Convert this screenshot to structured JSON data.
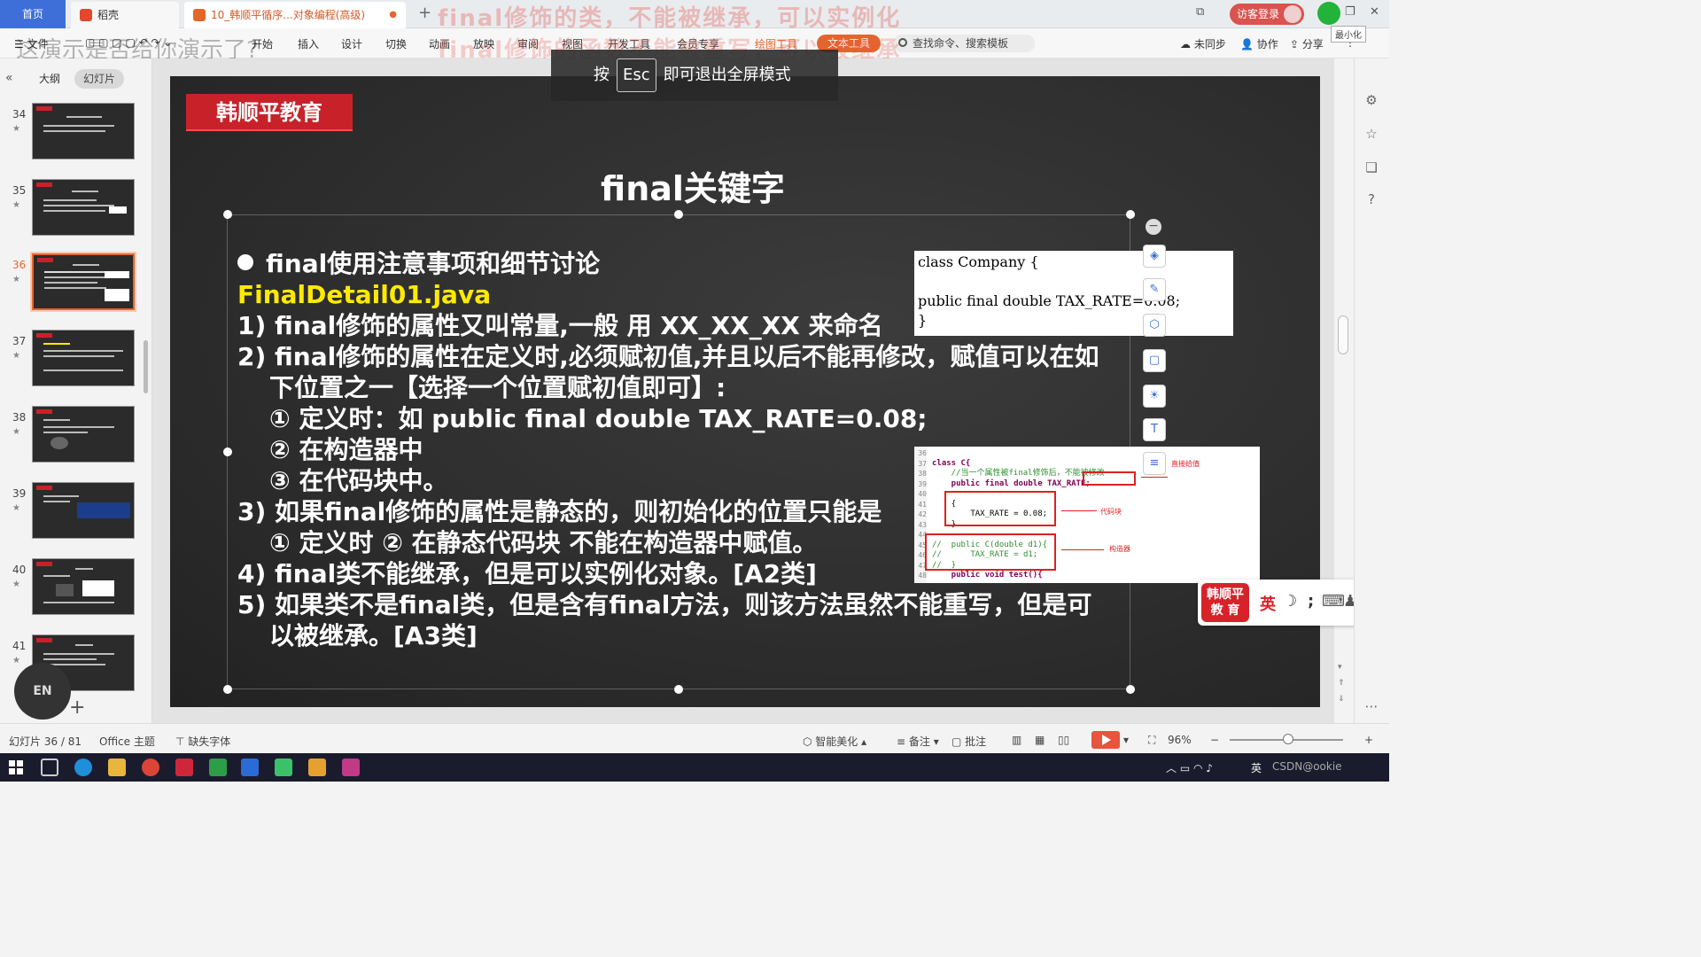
{
  "tabs": {
    "home": "首页",
    "doc": "稻壳",
    "ppt": "10_韩顺平循序...对象编程(高级)"
  },
  "overlay_text": {
    "line1": "final修饰的类，不能被继承，可以实例化",
    "line2": "final修饰的函数不能被重写，可以被继承",
    "sub": "这演示是否给你演示了?"
  },
  "window": {
    "login": "访客登录",
    "minimize_tip": "最小化"
  },
  "ribbon": {
    "file": "文件",
    "items": [
      "开始",
      "插入",
      "设计",
      "切换",
      "动画",
      "放映",
      "审阅",
      "视图",
      "开发工具",
      "会员专享"
    ],
    "drawing_tools": "绘图工具",
    "text_tools": "文本工具",
    "search": "查找命令、搜索模板",
    "unsynced": "未同步",
    "collab": "协作",
    "share": "分享"
  },
  "leftpanel": {
    "outline_tab": "大纲",
    "slides_tab": "幻灯片",
    "thumb_numbers": [
      "34",
      "35",
      "36",
      "37",
      "38",
      "39",
      "40",
      "41"
    ],
    "current": "36",
    "en_button": "EN"
  },
  "esc_hint": {
    "prefix": "按",
    "key": "Esc",
    "suffix": "即可退出全屏模式"
  },
  "slide": {
    "brand": "韩顺平教育",
    "title": "final关键字",
    "heading": "final使用注意事项和细节讨论",
    "filename": "FinalDetail01.java",
    "lines": [
      "1) final修饰的属性又叫常量,一般 用 XX_XX_XX 来命名",
      "2) final修饰的属性在定义时,必须赋初值,并且以后不能再修改，赋值可以在如",
      "下位置之一【选择一个位置赋初值即可】:",
      "① 定义时：如 public final double TAX_RATE=0.08;",
      "② 在构造器中",
      "③ 在代码块中。",
      "3) 如果final修饰的属性是静态的，则初始化的位置只能是",
      "① 定义时   ② 在静态代码块 不能在构造器中赋值。",
      "4) final类不能继承，但是可以实例化对象。[A2类]",
      "5) 如果类不是final类，但是含有final方法，则该方法虽然不能重写，但是可",
      "以被继承。[A3类]"
    ],
    "code1": [
      "class Company {",
      "",
      "public final double TAX_RATE=0.08;",
      "}"
    ],
    "code2": {
      "line_numbers": [
        "36",
        "37",
        "38",
        "39",
        "40",
        "41",
        "42",
        "43",
        "44",
        "45",
        "46",
        "47",
        "48"
      ],
      "lines": [
        "",
        "class C{",
        "    //当一个属性被final修饰后，不能被修改",
        "    public final double TAX_RATE;",
        "",
        "    {",
        "        TAX_RATE = 0.08;",
        "    }",
        "",
        "//  public C(double d1){",
        "//      TAX_RATE = d1;",
        "//  }",
        "    public void test(){"
      ],
      "annotations": [
        "直接给值",
        "代码块",
        "构造器"
      ]
    }
  },
  "ime": {
    "logo_line1": "韩顺平",
    "logo_line2": "教 育",
    "lang": "英"
  },
  "statusbar": {
    "slide_count": "幻灯片 36 / 81",
    "theme": "Office 主题",
    "missing_font": "缺失字体",
    "beautify": "智能美化",
    "notes": "备注",
    "comments": "批注",
    "zoom": "96%"
  },
  "taskbar": {
    "lang": "英",
    "watermark": "CSDN@ookie"
  }
}
